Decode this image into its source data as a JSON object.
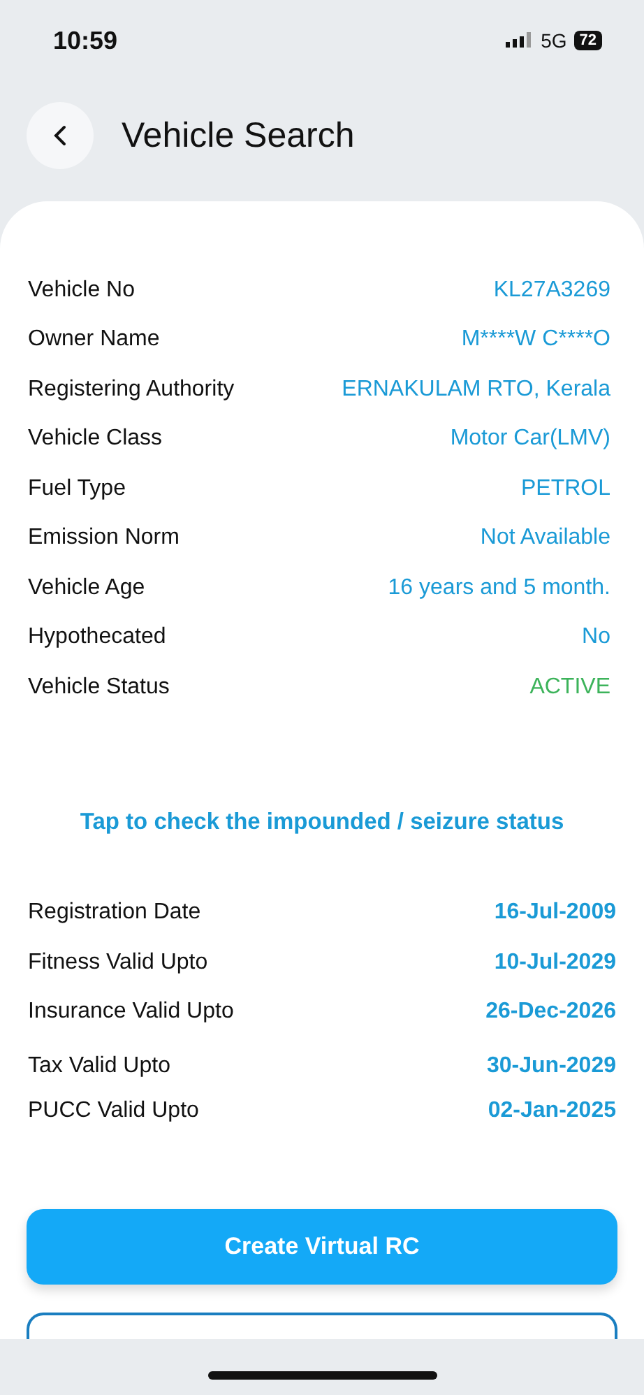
{
  "status_bar": {
    "time": "10:59",
    "network": "5G",
    "battery": "72"
  },
  "header": {
    "title": "Vehicle Search"
  },
  "details": [
    {
      "label": "Vehicle No",
      "value": "KL27A3269",
      "color": "#1a9ad6"
    },
    {
      "label": "Owner Name",
      "value": "M****W C****O",
      "color": "#1a9ad6"
    },
    {
      "label": "Registering Authority",
      "value": "ERNAKULAM RTO, Kerala",
      "color": "#1a9ad6"
    },
    {
      "label": "Vehicle Class",
      "value": "Motor Car(LMV)",
      "color": "#1a9ad6"
    },
    {
      "label": "Fuel Type",
      "value": "PETROL",
      "color": "#1a9ad6"
    },
    {
      "label": "Emission Norm",
      "value": "Not Available",
      "color": "#1a9ad6"
    },
    {
      "label": "Vehicle Age",
      "value": "16 years and 5 month.",
      "color": "#1a9ad6"
    },
    {
      "label": "Hypothecated",
      "value": "No",
      "color": "#1a9ad6"
    },
    {
      "label": "Vehicle Status",
      "value": "ACTIVE",
      "color": "#3cb35a"
    }
  ],
  "impound_link": "Tap to check the impounded / seizure status",
  "validity": [
    {
      "label": "Registration Date",
      "value": "16-Jul-2009"
    },
    {
      "label": "Fitness Valid Upto",
      "value": "10-Jul-2029"
    },
    {
      "label": "Insurance Valid Upto",
      "value": "26-Dec-2026"
    },
    {
      "label": "Tax Valid Upto",
      "value": "30-Jun-2029"
    },
    {
      "label": "PUCC Valid Upto",
      "value": "02-Jan-2025"
    }
  ],
  "buttons": [
    {
      "kind": "filled",
      "label": "Create Virtual RC"
    },
    {
      "kind": "outline"
    }
  ]
}
